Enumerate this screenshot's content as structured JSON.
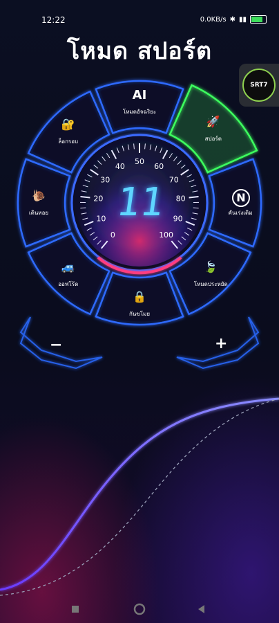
{
  "status_bar": {
    "time": "12:22",
    "network_speed": "0.0KB/s",
    "battery_color": "#3ddc5b"
  },
  "header": {
    "title": "โหมด สปอร์ต",
    "logo_text": "SRT7"
  },
  "modes": [
    {
      "label": "โหมดอัจฉริยะ",
      "icon": "ai-icon",
      "icon_text": "AI"
    },
    {
      "label": "สปอร์ต",
      "icon": "rocket-icon",
      "active": true
    },
    {
      "label": "คันเร่งเดิม",
      "icon": "n-icon",
      "icon_text": "N"
    },
    {
      "label": "โหมดประหยัด",
      "icon": "leaf-icon"
    },
    {
      "label": "กันขโมย",
      "icon": "lock-hand-icon"
    },
    {
      "label": "ออฟโร้ด",
      "icon": "offroad-car-icon"
    },
    {
      "label": "เดินหอย",
      "icon": "snail-icon"
    },
    {
      "label": "ล็อกรอบ",
      "icon": "lock-icon"
    }
  ],
  "gauge": {
    "current_level": "11",
    "scale": [
      "0",
      "10",
      "20",
      "30",
      "40",
      "50",
      "60",
      "70",
      "80",
      "90",
      "100"
    ]
  },
  "controls": {
    "minus_label": "−",
    "plus_label": "+"
  },
  "colors": {
    "accent_blue": "#2f6bff",
    "active_green": "#3dff5e",
    "curve_color": "#5a5cff"
  }
}
